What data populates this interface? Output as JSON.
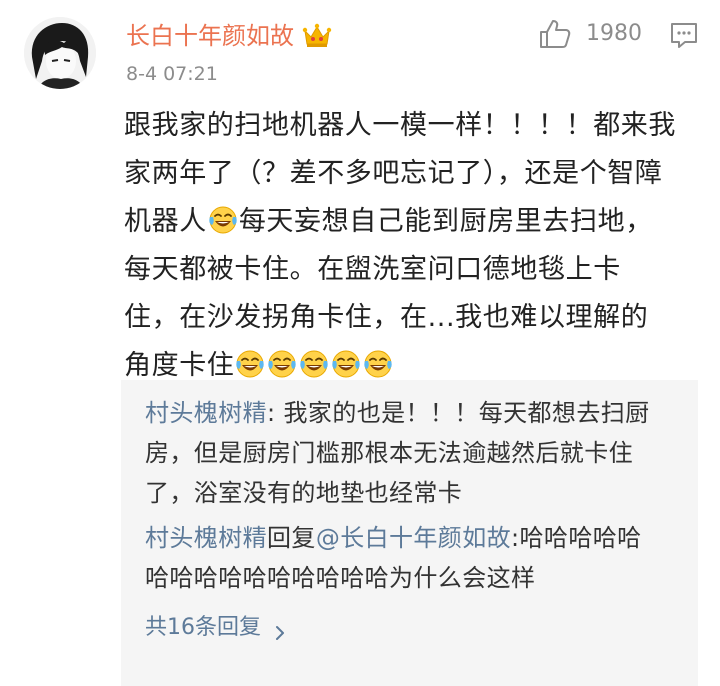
{
  "comment": {
    "username": "长白十年颜如故",
    "timestamp": "8-4 07:21",
    "like_count": "1980",
    "body_lines": [
      "跟我家的扫地机器人一模一样！！！！都来我",
      "家两年了（？差不多吧忘记了），还是个智障",
      "机器人",
      "每天妄想自己能到厨房里去扫地，",
      "每天都被卡住。在盥洗室问口德地毯上卡",
      "住，在沙发拐角卡住，在...我也难以理解的",
      "角度卡住"
    ],
    "emoji_name": "laughing-crying-emoji"
  },
  "replies": [
    {
      "user": "村头槐树精",
      "separator": ": ",
      "lines": [
        "我家的也是！！！每天都想去扫厨",
        "房，但是厨房门槛那根本无法逾越然后就卡住",
        "了，浴室没有的地垫也经常卡"
      ]
    },
    {
      "user": "村头槐树精",
      "reply_word": "回复",
      "mention": "@长白十年颜如故",
      "separator": ":",
      "lines": [
        "哈哈哈哈哈",
        "哈哈哈哈哈哈哈哈哈哈为什么会这样"
      ]
    }
  ],
  "total_replies_label": "共16条回复",
  "colors": {
    "username": "#eb7350",
    "reply_user": "#5d7a99",
    "meta": "#8c8c8c",
    "reply_bg": "#f5f5f5"
  },
  "icons": [
    "avatar-image",
    "vip-crown-icon",
    "thumbs-up-icon",
    "reply-comment-icon",
    "laughing-crying-emoji",
    "chevron-right-icon"
  ]
}
